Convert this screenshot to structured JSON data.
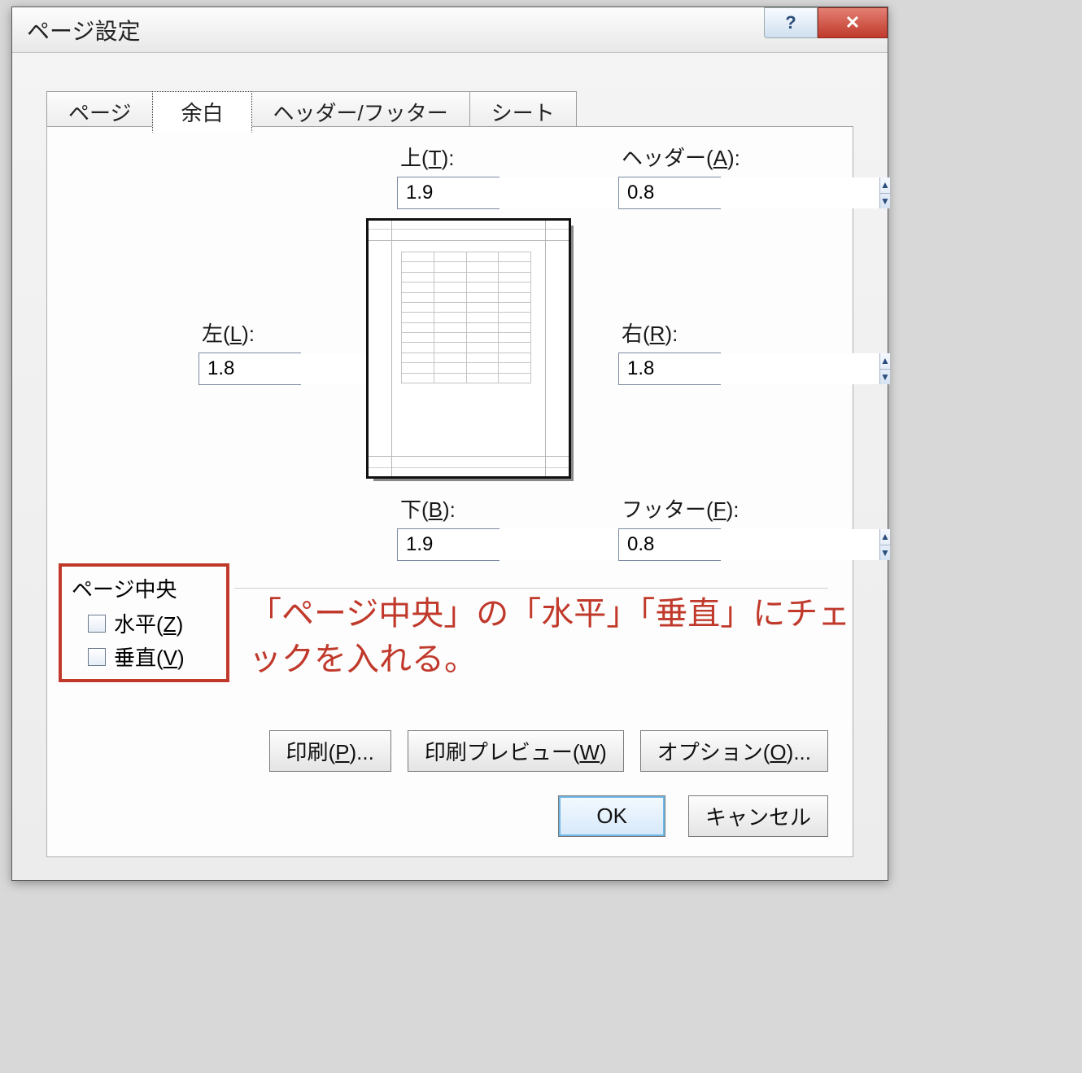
{
  "dialog": {
    "title": "ページ設定",
    "help_tooltip": "?",
    "close_tooltip": "✕"
  },
  "tabs": {
    "page": "ページ",
    "margins": "余白",
    "headerfooter": "ヘッダー/フッター",
    "sheet": "シート"
  },
  "margins": {
    "top": {
      "label_pre": "上(",
      "key": "T",
      "label_post": "):",
      "value": "1.9"
    },
    "header": {
      "label_pre": "ヘッダー(",
      "key": "A",
      "label_post": "):",
      "value": "0.8"
    },
    "left": {
      "label_pre": "左(",
      "key": "L",
      "label_post": "):",
      "value": "1.8"
    },
    "right": {
      "label_pre": "右(",
      "key": "R",
      "label_post": "):",
      "value": "1.8"
    },
    "bottom": {
      "label_pre": "下(",
      "key": "B",
      "label_post": "):",
      "value": "1.9"
    },
    "footer": {
      "label_pre": "フッター(",
      "key": "F",
      "label_post": "):",
      "value": "0.8"
    }
  },
  "center": {
    "group": "ページ中央",
    "horizontal": {
      "pre": "水平(",
      "key": "Z",
      "post": ")"
    },
    "vertical": {
      "pre": "垂直(",
      "key": "V",
      "post": ")"
    }
  },
  "annotation": "「ページ中央」の「水平」「垂直」にチェックを入れる。",
  "buttons": {
    "print": {
      "pre": "印刷(",
      "key": "P",
      "post": ")..."
    },
    "preview": {
      "pre": "印刷プレビュー(",
      "key": "W",
      "post": ")"
    },
    "options": {
      "pre": "オプション(",
      "key": "O",
      "post": ")..."
    },
    "ok": "OK",
    "cancel": "キャンセル"
  }
}
